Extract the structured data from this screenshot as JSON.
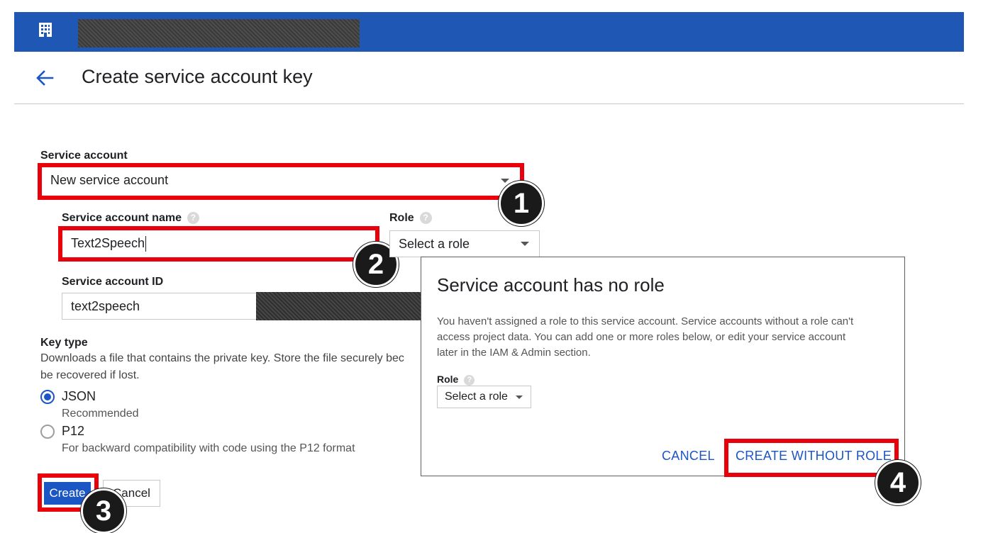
{
  "page": {
    "title": "Create service account key"
  },
  "service_account": {
    "label": "Service account",
    "selected": "New service account"
  },
  "account_name": {
    "label": "Service account name",
    "help": "?",
    "value": "Text2Speech"
  },
  "role": {
    "label": "Role",
    "help": "?",
    "selected": "Select a role"
  },
  "account_id": {
    "label": "Service account ID",
    "value": "text2speech"
  },
  "key_type": {
    "label": "Key type",
    "description": "Downloads a file that contains the private key. Store the file securely bec",
    "description_line2": "be recovered if lost.",
    "options": [
      {
        "label": "JSON",
        "sub": "Recommended",
        "checked": true
      },
      {
        "label": "P12",
        "sub": "For backward compatibility with code using the P12 format",
        "checked": false
      }
    ]
  },
  "actions": {
    "create": "Create",
    "cancel": "Cancel"
  },
  "dialog": {
    "title": "Service account has no role",
    "text": "You haven't assigned a role to this service account. Service accounts without a role can't access project data. You can add one or more roles below, or edit your service account later in the IAM & Admin section.",
    "role_label": "Role",
    "role_help": "?",
    "role_selected": "Select a role",
    "cancel": "CANCEL",
    "create_without_role": "CREATE WITHOUT ROLE"
  },
  "steps": [
    "1",
    "2",
    "3",
    "4"
  ],
  "colors": {
    "topbar": "#1f57b5",
    "accent": "#1a56c4",
    "highlight": "#e8000b",
    "badge": "#1a1a1a"
  },
  "icons": {
    "topbar": "building-icon",
    "back": "arrow-left-icon",
    "dropdown": "caret-down-icon"
  }
}
